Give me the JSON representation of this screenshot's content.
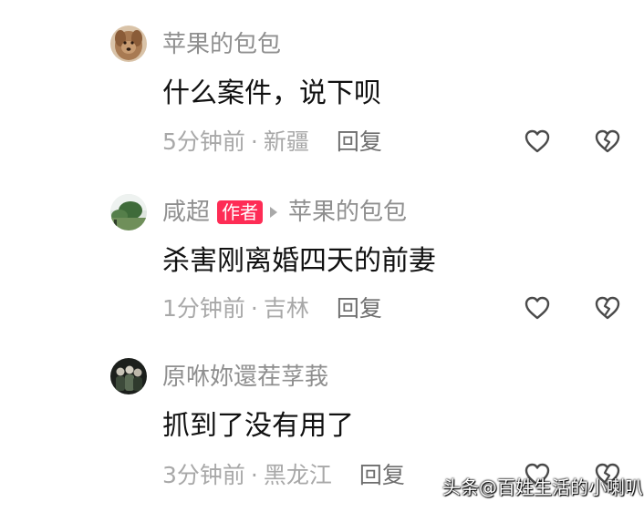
{
  "comments": [
    {
      "username": "苹果的包包",
      "text": "什么案件，说下呗",
      "time": "5分钟前",
      "separator": "·",
      "location": "新疆",
      "reply_label": "回复",
      "avatar_icon": "brown-dog-avatar"
    },
    {
      "username": "咸超",
      "author_badge": "作者",
      "reply_to": "苹果的包包",
      "text": "杀害刚离婚四天的前妻",
      "time": "1分钟前",
      "separator": "·",
      "location": "吉林",
      "reply_label": "回复",
      "avatar_icon": "landscape-avatar"
    },
    {
      "username": "原咻妳還茬莩莪",
      "text": "抓到了没有用了",
      "time": "3分钟前",
      "separator": "·",
      "location": "黑龙江",
      "reply_label": "回复",
      "avatar_icon": "group-photo-avatar"
    }
  ],
  "icons": {
    "like": "heart-outline-icon",
    "dislike": "broken-heart-outline-icon"
  },
  "colors": {
    "username": "#8f8f8f",
    "badge": "#fe2c55",
    "meta": "#a8a8a8",
    "reply": "#6e6e6e"
  },
  "watermark": "头条@百姓生活的小喇叭"
}
